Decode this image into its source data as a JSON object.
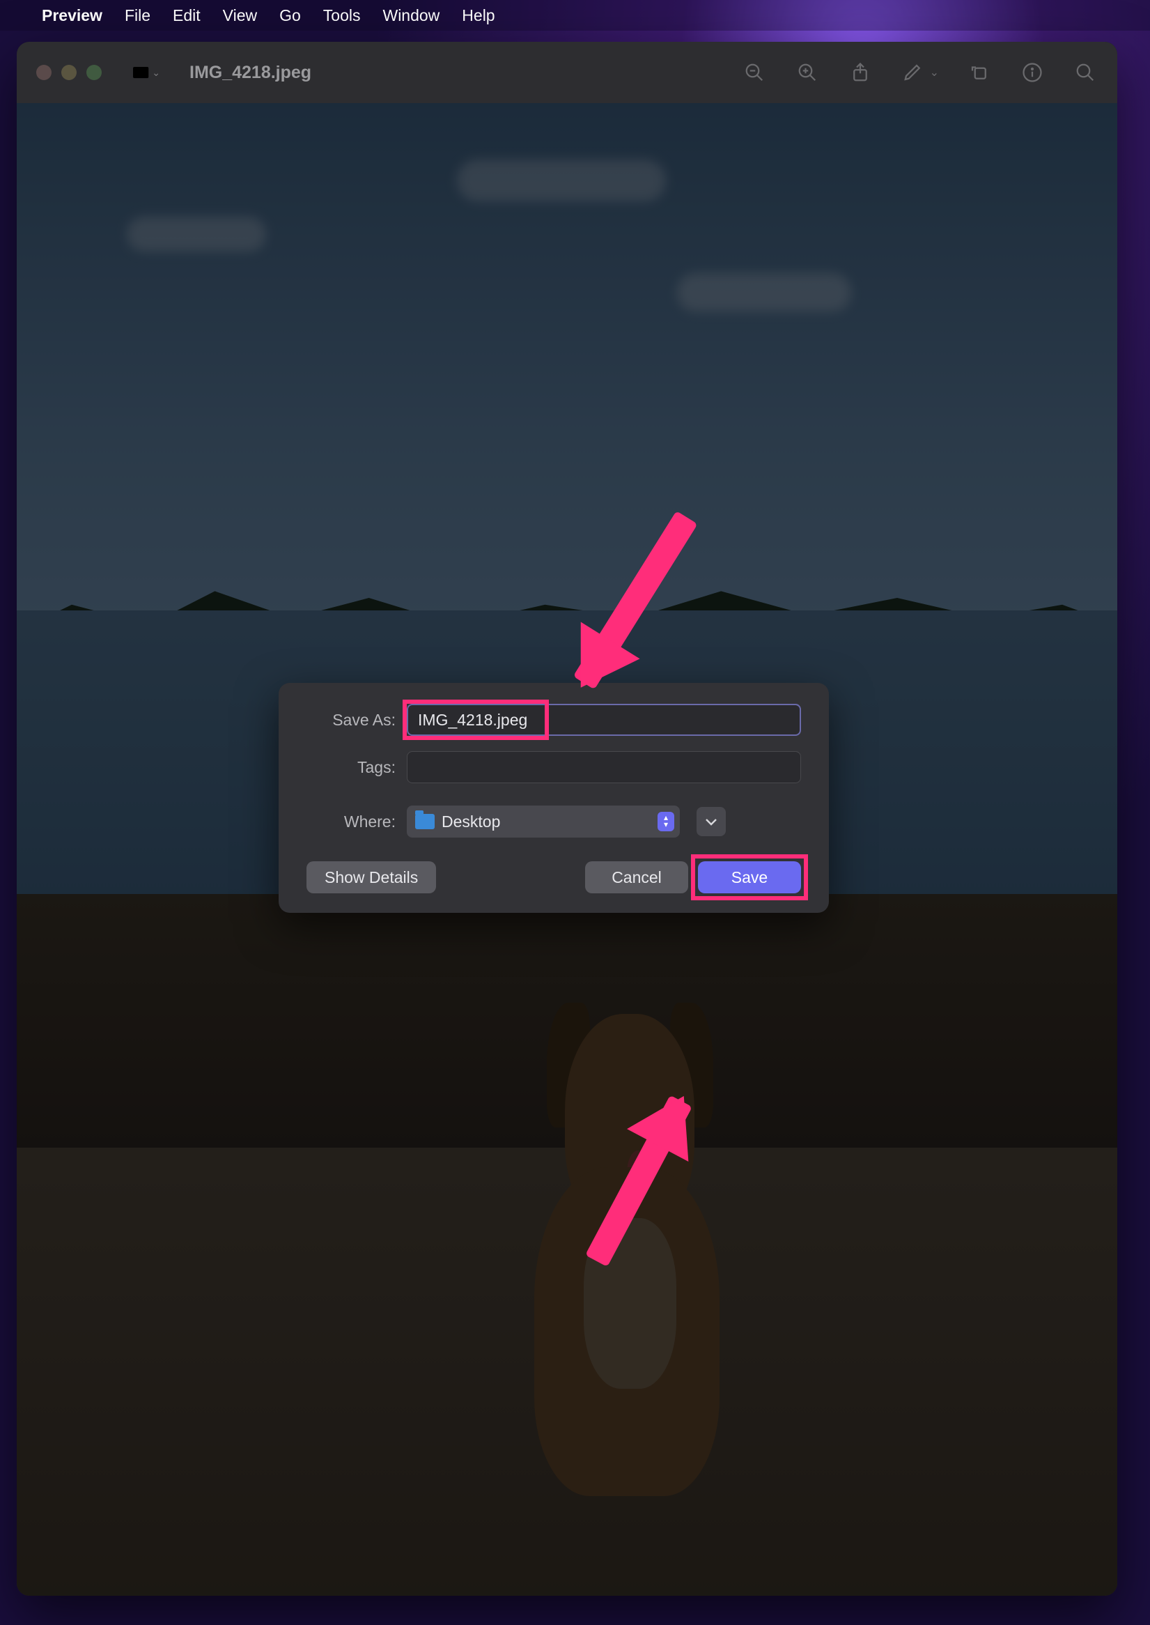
{
  "menubar": {
    "app_name": "Preview",
    "items": [
      "File",
      "Edit",
      "View",
      "Go",
      "Tools",
      "Window",
      "Help"
    ]
  },
  "window": {
    "title": "IMG_4218.jpeg"
  },
  "dialog": {
    "save_as_label": "Save As:",
    "save_as_value": "IMG_4218.jpeg",
    "tags_label": "Tags:",
    "tags_value": "",
    "where_label": "Where:",
    "where_value": "Desktop",
    "show_details_label": "Show Details",
    "cancel_label": "Cancel",
    "save_label": "Save"
  }
}
